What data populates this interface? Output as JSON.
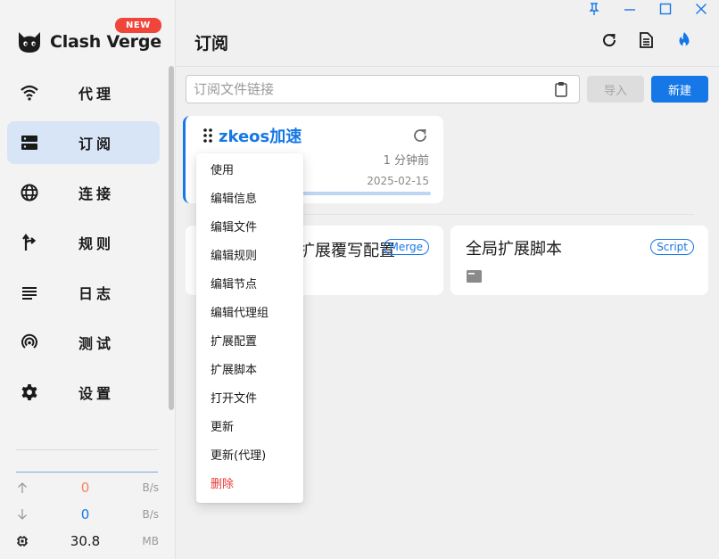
{
  "app": {
    "name": "Clash Verge",
    "badge": "NEW"
  },
  "sidebar": {
    "items": [
      {
        "label": "代理",
        "icon": "wifi-icon"
      },
      {
        "label": "订阅",
        "icon": "server-icon",
        "active": true
      },
      {
        "label": "连接",
        "icon": "globe-icon"
      },
      {
        "label": "规则",
        "icon": "route-icon"
      },
      {
        "label": "日志",
        "icon": "list-icon"
      },
      {
        "label": "测试",
        "icon": "radar-icon"
      },
      {
        "label": "设置",
        "icon": "gear-icon"
      }
    ],
    "traffic": {
      "upload": {
        "value": "0",
        "unit": "B/s",
        "color": "#f4845f"
      },
      "download": {
        "value": "0",
        "unit": "B/s",
        "color": "#1677e6"
      },
      "memory": {
        "value": "30.8",
        "unit": "MB"
      }
    }
  },
  "header": {
    "title": "订阅",
    "icons": [
      "refresh-icon",
      "file-text-icon",
      "fire-icon"
    ]
  },
  "toolbar": {
    "input_placeholder": "订阅文件链接",
    "input_value": "",
    "import_label": "导入",
    "new_label": "新建"
  },
  "profile": {
    "name": "zkeos加速",
    "updated": "1 分钟前",
    "date": "2025-02-15",
    "usage_fraction": 1.0
  },
  "enhance_cards": [
    {
      "title": "全局扩展覆写配置",
      "chip": "Merge"
    },
    {
      "title": "全局扩展脚本",
      "chip": "Script"
    }
  ],
  "context_menu": {
    "items": [
      "使用",
      "编辑信息",
      "编辑文件",
      "编辑规则",
      "编辑节点",
      "编辑代理组",
      "扩展配置",
      "扩展脚本",
      "打开文件",
      "更新",
      "更新(代理)",
      "删除"
    ],
    "danger_color": "#e53935"
  },
  "colors": {
    "accent": "#1677e6",
    "badge": "#f0453a",
    "active_nav": "#d8e5f7"
  }
}
